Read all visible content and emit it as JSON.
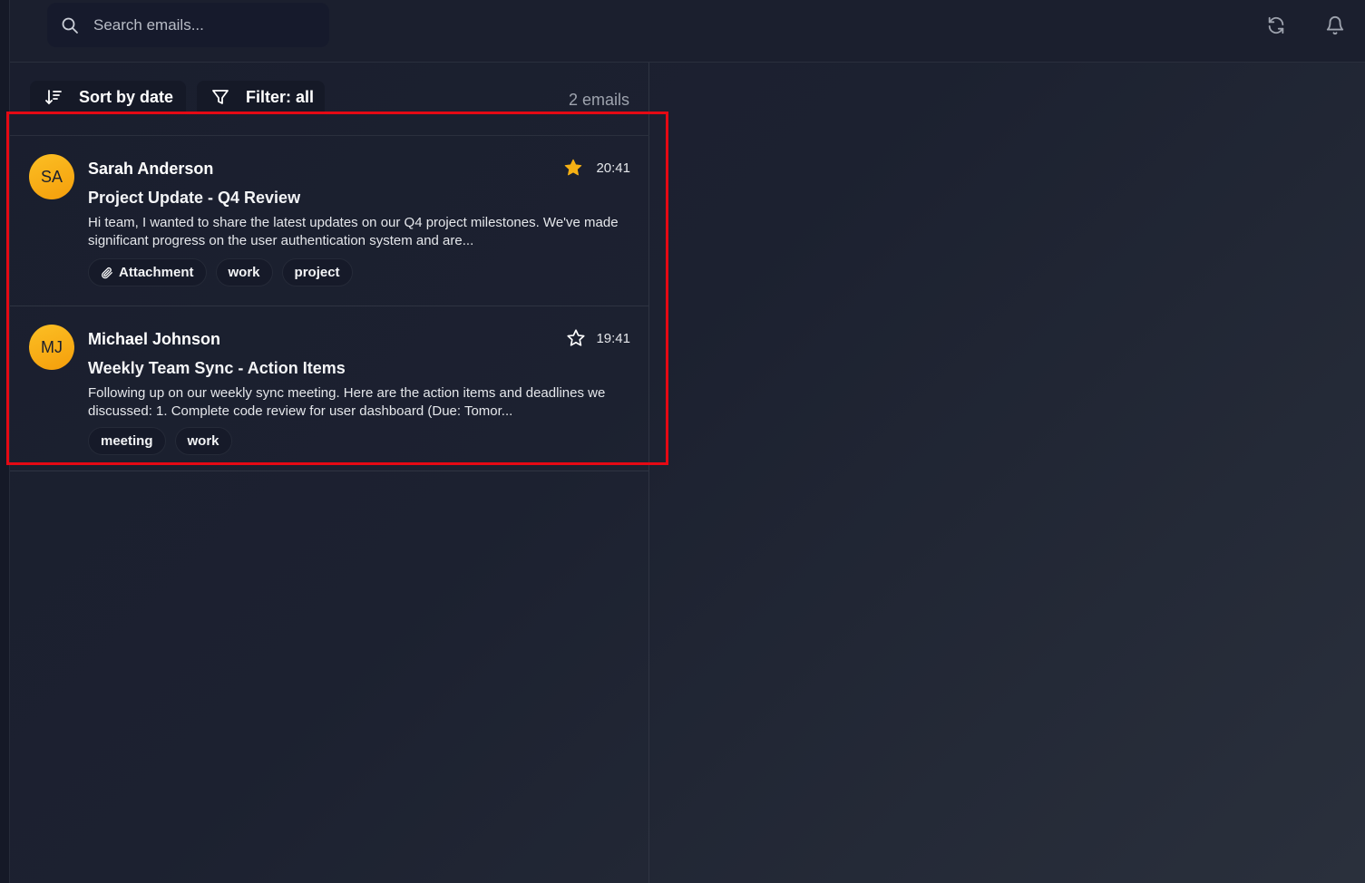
{
  "search": {
    "placeholder": "Search emails..."
  },
  "topbar": {
    "refresh_icon": "refresh-icon",
    "notifications_icon": "bell-icon"
  },
  "toolbar": {
    "sort_label": "Sort by date",
    "filter_label": "Filter: all",
    "count_label": "2 emails"
  },
  "emails": [
    {
      "initials": "SA",
      "sender": "Sarah Anderson",
      "time": "20:41",
      "starred": true,
      "subject": "Project Update - Q4 Review",
      "preview": "Hi team, I wanted to share the latest updates on our Q4 project milestones. We've made significant progress on the user authentication system and are...",
      "attachment_label": "Attachment",
      "tags": [
        "work",
        "project"
      ]
    },
    {
      "initials": "MJ",
      "sender": "Michael Johnson",
      "time": "19:41",
      "starred": false,
      "subject": "Weekly Team Sync - Action Items",
      "preview": "Following up on our weekly sync meeting. Here are the action items and deadlines we discussed: 1. Complete code review for user dashboard (Due: Tomor...",
      "tags": [
        "meeting",
        "work"
      ]
    }
  ],
  "colors": {
    "accent_star": "#f5b014",
    "avatar": "#fbbf24",
    "highlight_box": "#e50914",
    "background": "#1b1f2e"
  }
}
